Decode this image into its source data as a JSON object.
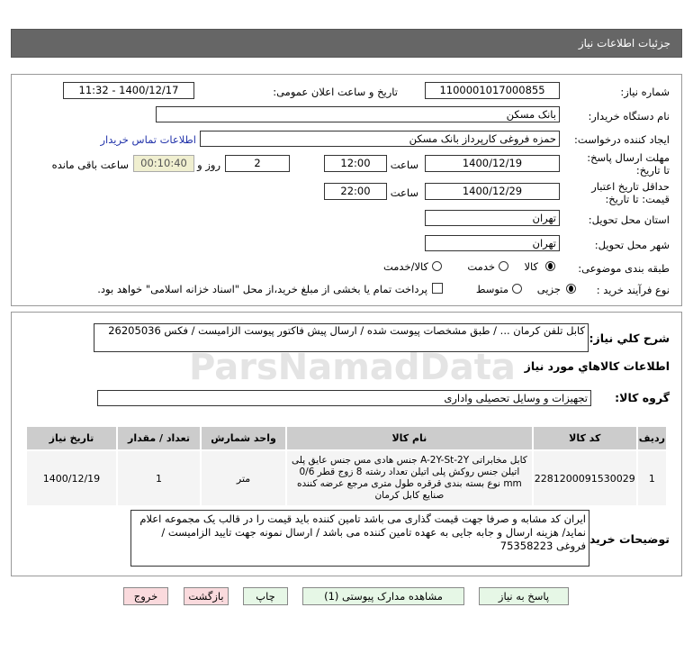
{
  "header": {
    "title": "جزئیات اطلاعات نیاز"
  },
  "form": {
    "need_number_label": "شماره نیاز:",
    "need_number": "1100001017000855",
    "announce_label": "تاریخ و ساعت اعلان عمومی:",
    "announce_value": "1400/12/17 - 11:32",
    "buyer_label": "نام دستگاه خریدار:",
    "buyer": "بانک مسکن",
    "creator_label": "ایجاد کننده درخواست:",
    "creator": "حمزه فروغی کارپرداز بانک مسکن",
    "contact_link": "اطلاعات تماس خریدار",
    "deadline_label": "مهلت ارسال پاسخ: تا تاریخ:",
    "deadline_date": "1400/12/19",
    "time_label": "ساعت",
    "deadline_time": "12:00",
    "days": "2",
    "days_label": "روز و",
    "remaining": "00:10:40",
    "remaining_label": "ساعت باقی مانده",
    "validity_label": "حداقل تاریخ اعتبار قیمت: تا تاریخ:",
    "validity_date": "1400/12/29",
    "validity_time": "22:00",
    "province_label": "استان محل تحویل:",
    "province": "تهران",
    "city_label": "شهر محل تحویل:",
    "city": "تهران",
    "category_label": "طبقه بندی موضوعی:",
    "category_options": [
      "کالا",
      "خدمت",
      "کالا/خدمت"
    ],
    "category_selected": "کالا",
    "process_label": "نوع فرآیند خرید :",
    "process_options": [
      "جزیی",
      "متوسط"
    ],
    "process_selected": "جزیی",
    "payment_note": "پرداخت تمام یا بخشی از مبلغ خرید،از محل \"اسناد خزانه اسلامی\" خواهد بود."
  },
  "details": {
    "summary_label": "شرح کلي نياز:",
    "summary": "کابل تلفن کرمان ... / طبق مشخصات پیوست شده / ارسال پیش فاکتور پیوست الزامیست / فکس 26205036",
    "items_title": "اطلاعات کالاهاي مورد نياز",
    "group_label": "گروه کالا:",
    "group": "تجهیزات و وسایل تحصیلی واداری",
    "table": {
      "headers": [
        "ردیف",
        "کد کالا",
        "نام کالا",
        "واحد شمارش",
        "تعداد / مقدار",
        "تاریخ نیاز"
      ],
      "rows": [
        [
          "1",
          "2281200091530029",
          "کابل مخابراتی A-2Y-St-2Y جنس هادی مس جنس عایق پلی اتیلن جنس روکش پلی اتیلن تعداد رشته 8 زوج قطر 0/6 mm نوع بسته بندی قرقره طول متری مرجع عرضه کننده صنایع کابل کرمان",
          "متر",
          "1",
          "1400/12/19"
        ]
      ]
    },
    "notes_label": "توضیحات خریدار:",
    "notes": "ایران کد مشابه و صرفا جهت قیمت گذاری می باشد تامین کننده باید قیمت را در قالب یک مجموعه اعلام نماید/ هزینه ارسال و جابه جایی به عهده تامین کننده می باشد / ارسال نمونه جهت تایید الزامیست / فروغی 75358223"
  },
  "watermark": "ParsNamadData",
  "buttons": {
    "reply": "پاسخ به نیاز",
    "attachments": "مشاهده مدارک پیوستی (1)",
    "print": "چاپ",
    "back": "بازگشت",
    "exit": "خروج"
  },
  "colors": {
    "header_bg": "#666666",
    "remaining_bg": "#f0efd0",
    "exit_bg": "#fadadd",
    "nav_bg": "#e6f7e6"
  }
}
